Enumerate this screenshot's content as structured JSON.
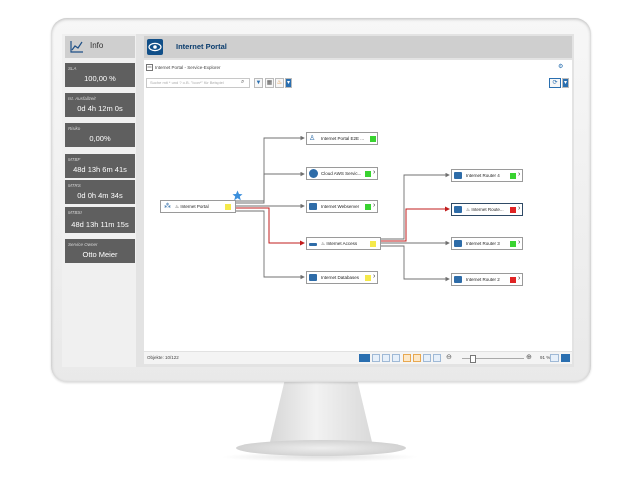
{
  "info_panel": {
    "title": "Info",
    "tiles": [
      {
        "label": "SLA",
        "value": "100,00 %"
      },
      {
        "label": "Ist. Ausfallzeit",
        "value": "0d 4h 12m 0s"
      },
      {
        "label": "Risiko",
        "value": "0,00%"
      },
      {
        "label": "MTBF",
        "value": "48d 13h 6m 41s"
      },
      {
        "label": "MTRS",
        "value": "0d 0h 4m 34s"
      },
      {
        "label": "MTBSI",
        "value": "48d 13h 11m 15s"
      },
      {
        "label": "Service Owner",
        "value": "Otto Meier"
      }
    ]
  },
  "header": {
    "title": "Internet Portal"
  },
  "explorer": {
    "subtitle": "Internet Portal - Service-Explorer",
    "search_placeholder": "Suche mit * und ? o.B. \"Icon*\" für Beispiel"
  },
  "nodes": {
    "root": {
      "label": "Internet Portal",
      "status": "#f5e94a"
    },
    "e2e": {
      "label": "Internet Portal E2E ...",
      "status": "#39d330"
    },
    "aws": {
      "label": "Cloud AWS Servic...",
      "status": "#39d330"
    },
    "web": {
      "label": "Internet Webserver",
      "status": "#39d330"
    },
    "access": {
      "label": "Internet Access",
      "status": "#f5e94a"
    },
    "db": {
      "label": "Internet Databases",
      "status": "#f5e94a"
    },
    "r4": {
      "label": "Internet Router 4",
      "status": "#39d330"
    },
    "rx": {
      "label": "Internet Route...",
      "status": "#e02424"
    },
    "r3": {
      "label": "Internet Router 3",
      "status": "#39d330"
    },
    "r2": {
      "label": "Internet Router 2",
      "status": "#e02424"
    }
  },
  "colors": {
    "accent": "#114f88",
    "critical_link": "#c21c1c",
    "link": "#707070"
  },
  "footer": {
    "objects": "Objekte: 10/122",
    "zoom": "91 %"
  }
}
